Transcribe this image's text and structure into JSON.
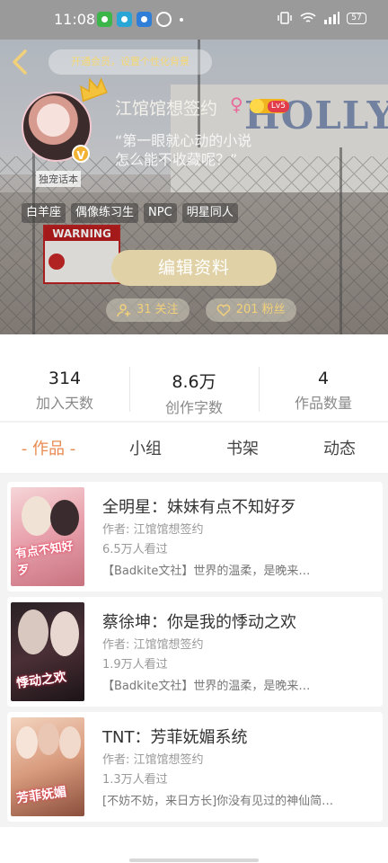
{
  "status_bar": {
    "time": "11:08",
    "battery": "57",
    "signal_label": "2G"
  },
  "header": {
    "vip_banner": "开通会员，设置个性化背景",
    "avatar_tag": "独宠话本",
    "username": "江馆馆想签约",
    "gender_symbol": "♀",
    "level": "Lv5",
    "bio_line1": "“第一眼就心动的小说",
    "bio_line2": "怎么能不收藏呢？”",
    "tags": [
      "白羊座",
      "偶像练习生",
      "NPC",
      "明星同人"
    ],
    "edit_button": "编辑资料",
    "following": "31 关注",
    "fans": "201 粉丝",
    "background_sign": "HOLLYWOOD",
    "warning_sign": "WARNING"
  },
  "stats": [
    {
      "value": "314",
      "label": "加入天数"
    },
    {
      "value": "8.6万",
      "label": "创作字数"
    },
    {
      "value": "4",
      "label": "作品数量"
    }
  ],
  "tabs": [
    {
      "label": "- 作品 -",
      "active": true
    },
    {
      "label": "小组",
      "active": false
    },
    {
      "label": "书架",
      "active": false
    },
    {
      "label": "动态",
      "active": false
    }
  ],
  "books": [
    {
      "title": "全明星：妹妹有点不知好歹",
      "author": "作者: 江馆馆想签约",
      "views": "6.5万人看过",
      "desc": "【Badkite文社】世界的温柔，是晚来…",
      "cover_art": "有点不知好歹"
    },
    {
      "title": "蔡徐坤：你是我的悸动之欢",
      "author": "作者: 江馆馆想签约",
      "views": "1.9万人看过",
      "desc": "【Badkite文社】世界的温柔，是晚来…",
      "cover_art": "悸动之欢"
    },
    {
      "title": "TNT：芳菲妩媚系统",
      "author": "作者: 江馆馆想签约",
      "views": "1.3万人看过",
      "desc": "[不妨不妨，来日方长]你没有见过的神仙简…",
      "cover_art": "芳菲妩媚"
    }
  ],
  "colors": {
    "accent": "#e88a4f",
    "gold": "#e0d2a6",
    "vip_text": "#f6d774"
  }
}
